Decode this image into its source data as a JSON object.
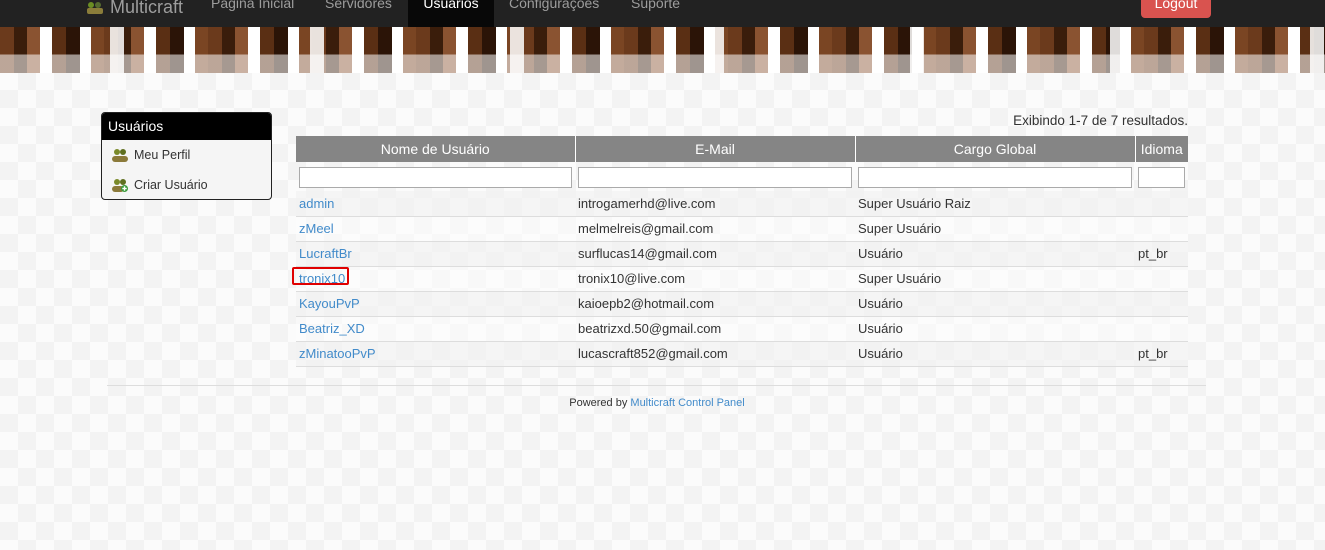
{
  "nav": {
    "brand": "Multicraft",
    "items": [
      {
        "label": "Página Inicial",
        "active": false
      },
      {
        "label": "Servidores",
        "active": false
      },
      {
        "label": "Usuários",
        "active": true
      },
      {
        "label": "Configurações",
        "active": false
      },
      {
        "label": "Suporte",
        "active": false
      }
    ],
    "logout_label": "Logout"
  },
  "sidebar": {
    "title": "Usuários",
    "items": [
      {
        "label": "Meu Perfil",
        "icon": "users-icon"
      },
      {
        "label": "Criar Usuário",
        "icon": "add-user-icon"
      }
    ]
  },
  "summary": "Exibindo 1-7 de 7 resultados.",
  "grid": {
    "columns": [
      "Nome de Usuário",
      "E-Mail",
      "Cargo Global",
      "Idioma"
    ],
    "filters": [
      "",
      "",
      "",
      ""
    ],
    "rows": [
      {
        "name": "admin",
        "email": "introgamerhd@live.com",
        "role": "Super Usuário Raiz",
        "lang": ""
      },
      {
        "name": "zMeel",
        "email": "melmelreis@gmail.com",
        "role": "Super Usuário",
        "lang": ""
      },
      {
        "name": "LucraftBr",
        "email": "surflucas14@gmail.com",
        "role": "Usuário",
        "lang": "pt_br"
      },
      {
        "name": "tronix10",
        "email": "tronix10@live.com",
        "role": "Super Usuário",
        "lang": ""
      },
      {
        "name": "KayouPvP",
        "email": "kaioepb2@hotmail.com",
        "role": "Usuário",
        "lang": ""
      },
      {
        "name": "Beatriz_XD",
        "email": "beatrizxd.50@gmail.com",
        "role": "Usuário",
        "lang": ""
      },
      {
        "name": "zMinatooPvP",
        "email": "lucascraft852@gmail.com",
        "role": "Usuário",
        "lang": "pt_br"
      }
    ]
  },
  "footer": {
    "prefix": "Powered by",
    "link": "Multicraft Control Panel"
  },
  "colors": {
    "accent_link": "#428bca",
    "logout": "#d9534f",
    "highlight": "#e00000"
  }
}
